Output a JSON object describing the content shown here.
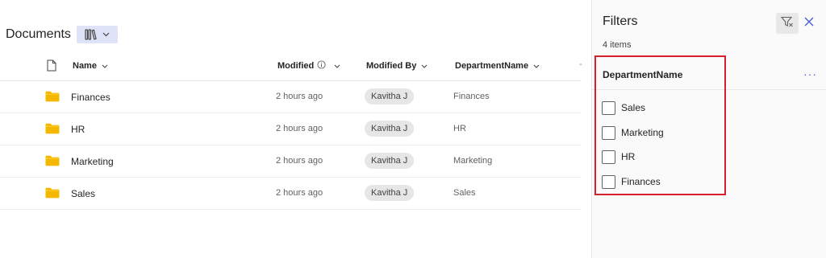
{
  "library": {
    "title": "Documents",
    "view_icon": "library-books-icon"
  },
  "columns": {
    "file_type_icon": "document-icon",
    "name": "Name",
    "modified": "Modified",
    "modified_by": "Modified By",
    "department": "DepartmentName",
    "more_sep": "-"
  },
  "rows": [
    {
      "name": "Finances",
      "modified": "2 hours ago",
      "modified_by": "Kavitha J",
      "department": "Finances"
    },
    {
      "name": "HR",
      "modified": "2 hours ago",
      "modified_by": "Kavitha J",
      "department": "HR"
    },
    {
      "name": "Marketing",
      "modified": "2 hours ago",
      "modified_by": "Kavitha J",
      "department": "Marketing"
    },
    {
      "name": "Sales",
      "modified": "2 hours ago",
      "modified_by": "Kavitha J",
      "department": "Sales"
    }
  ],
  "filters": {
    "title": "Filters",
    "count": "4 items",
    "section_title": "DepartmentName",
    "more": "···",
    "options": [
      {
        "label": "Sales",
        "checked": false
      },
      {
        "label": "Marketing",
        "checked": false
      },
      {
        "label": "HR",
        "checked": false
      },
      {
        "label": "Finances",
        "checked": false
      }
    ]
  },
  "colors": {
    "accent": "#4a5ecf",
    "folder": "#f5b800",
    "highlight": "#d6202b",
    "view_switch_bg": "#dfe3f7"
  }
}
